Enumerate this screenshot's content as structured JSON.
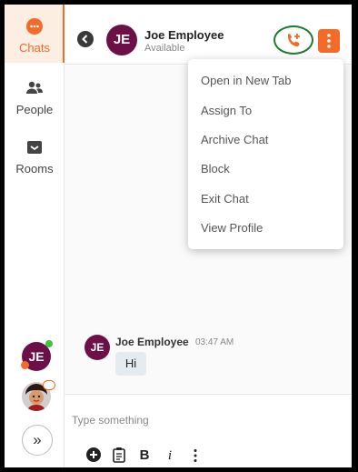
{
  "sidebar": {
    "items": [
      {
        "label": "Chats",
        "active": true
      },
      {
        "label": "People",
        "active": false
      },
      {
        "label": "Rooms",
        "active": false
      }
    ],
    "user_avatar_initials": "JE",
    "expand_icon": "chevron-double-right-icon"
  },
  "header": {
    "contact_initials": "JE",
    "contact_name": "Joe Employee",
    "contact_status": "Available"
  },
  "menu": {
    "items": [
      "Open in New Tab",
      "Assign To",
      "Archive Chat",
      "Block",
      "Exit Chat",
      "View Profile"
    ]
  },
  "messages": [
    {
      "initials": "JE",
      "author": "Joe Employee",
      "time": "03:47 AM",
      "text": "Hi"
    }
  ],
  "composer": {
    "placeholder": "Type something",
    "bold_label": "B",
    "italic_label": "i"
  },
  "colors": {
    "accent": "#f26b28",
    "avatar": "#6d1047",
    "call_ring": "#1d7a2e",
    "online": "#3cc43c"
  }
}
